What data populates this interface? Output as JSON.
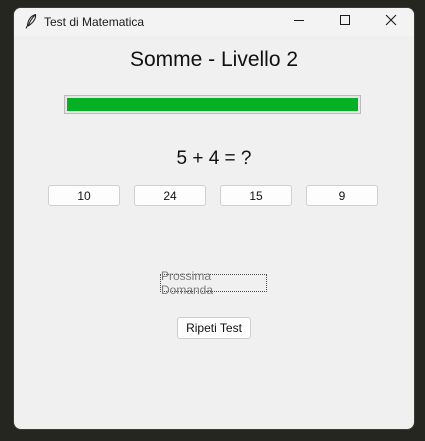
{
  "window": {
    "title": "Test di Matematica",
    "app_icon": "feather-icon",
    "controls": [
      "minimize-icon",
      "maximize-icon",
      "close-icon"
    ]
  },
  "main": {
    "heading": "Somme - Livello 2",
    "progress": {
      "value": 1.0,
      "color": "#06b025"
    },
    "question": "5 + 4 = ?",
    "answers": [
      "10",
      "24",
      "15",
      "9"
    ],
    "next_label": "Prossima Domanda",
    "repeat_label": "Ripeti Test"
  }
}
